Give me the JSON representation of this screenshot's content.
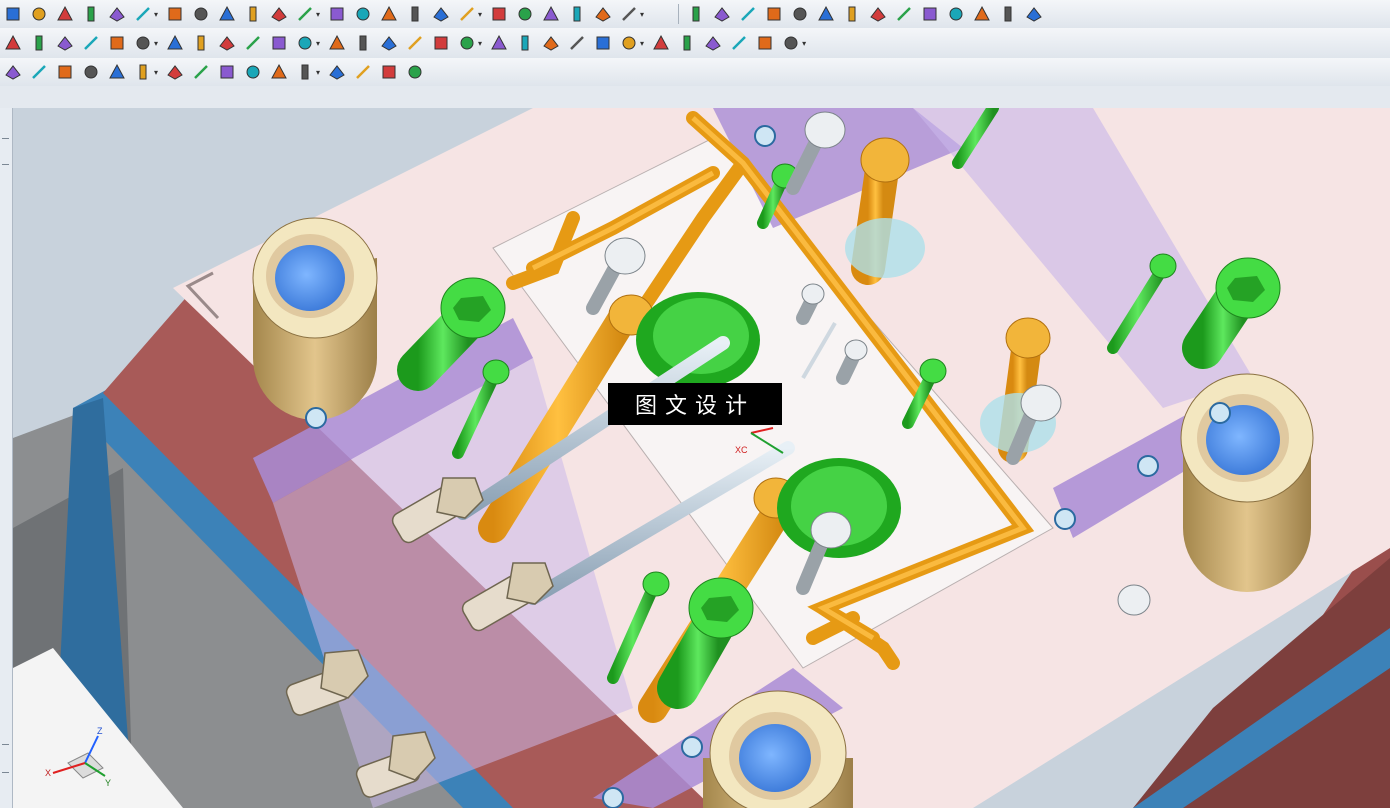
{
  "toolbars": {
    "row1_icons": [
      "rotate-icon",
      "sketch-icon",
      "extrude-icon",
      "shape-icon",
      "block-icon",
      "blend-icon",
      "edge-blend-icon",
      "chamfer-icon",
      "face-icon",
      "shell-icon",
      "trim-body-icon",
      "wave-icon",
      "draft-icon",
      "offset-face-icon",
      "mirror-icon",
      "pattern-icon",
      "unite-icon",
      "subtract-icon",
      "intersect-icon",
      "split-body-icon",
      "sew-icon",
      "patch-icon",
      "measure-icon",
      "analysis-icon"
    ],
    "row1_right_icons": [
      "target-icon",
      "pin-icon",
      "bolt-icon",
      "eye-icon",
      "eye-red-icon",
      "question-icon",
      "ejector-icon",
      "slider-icon",
      "lifter-icon",
      "cooling-icon",
      "insert-icon",
      "runner-icon",
      "gate-icon",
      "mold-base-icon"
    ],
    "row2_icons": [
      "stop-icon",
      "part-icon",
      "pin-icon",
      "pocket-icon",
      "sleeve-icon",
      "thermometer-icon",
      "text-icon",
      "hatch-icon",
      "chart-icon",
      "layer-icon",
      "cube-red-icon",
      "diamond-icon",
      "box-icon",
      "arrange-icon",
      "cage-icon",
      "color-palette-icon",
      "split-icon",
      "line-icon",
      "crosshair-icon",
      "multi-line-icon",
      "grid-icon",
      "stripes-icon",
      "section-icon",
      "angle-icon",
      "tilt-icon",
      "flag-icon",
      "delete-icon",
      "broom-icon",
      "paint-icon",
      "cube-outline-icon"
    ],
    "row3_icons": [
      "snap-icon",
      "select-arrow-icon",
      "filter-box-icon",
      "solid-icon",
      "sheet-icon",
      "point-icon",
      "mid-point-icon",
      "line-point-icon",
      "curve-icon",
      "arc-icon",
      "circle-center-icon",
      "quadrant-icon",
      "intersection-icon",
      "end-point-icon",
      "face-point-icon",
      "grid-snap-icon"
    ]
  },
  "viewport": {
    "overlay_label": "图文设计",
    "axis_labels": {
      "xc": "XC",
      "x": "X",
      "y": "Y",
      "z": "Z"
    },
    "colors": {
      "mold_plate": "#f6e4e4",
      "plate_side": "#a85a58",
      "water_channel": "#f0a820",
      "bolt_green": "#38c838",
      "guide_bushing": "#d9b878",
      "clamp_purple": "#a98cd6",
      "base_blue": "#3c82b8",
      "insert_white": "#f8f4f4"
    }
  }
}
